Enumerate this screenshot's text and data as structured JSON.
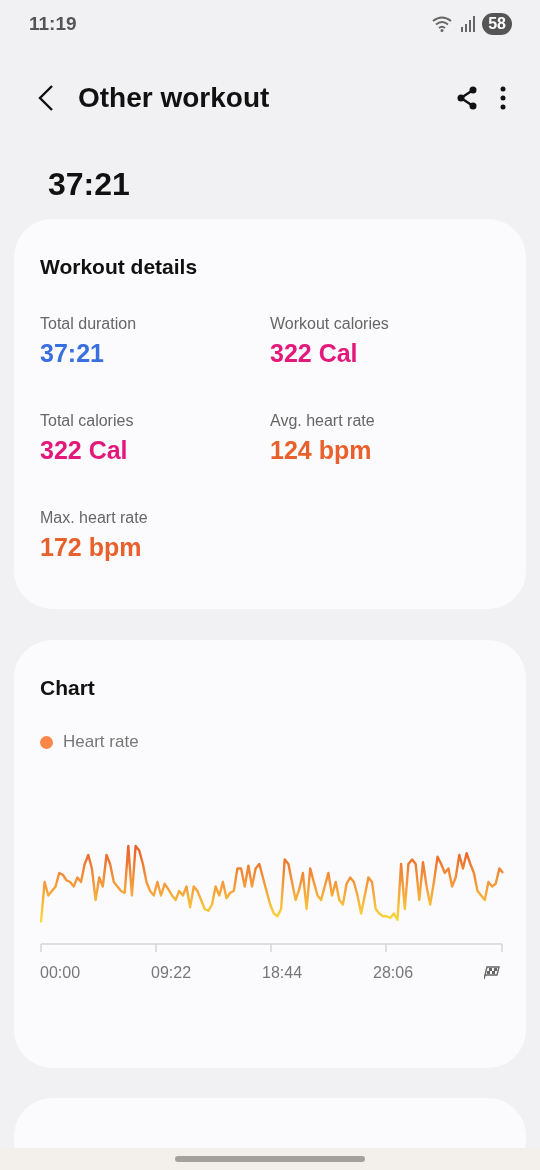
{
  "status_bar": {
    "time": "11:19",
    "battery": "58"
  },
  "header": {
    "title": "Other workout"
  },
  "duration": "37:21",
  "workout_details": {
    "title": "Workout details",
    "metrics": [
      {
        "label": "Total duration",
        "value": "37:21",
        "color": "#3a6fe0"
      },
      {
        "label": "Workout calories",
        "value": "322 Cal",
        "color": "#e2197b"
      },
      {
        "label": "Total calories",
        "value": "322 Cal",
        "color": "#e2197b"
      },
      {
        "label": "Avg. heart rate",
        "value": "124 bpm",
        "color": "#e8612c"
      },
      {
        "label": "Max. heart rate",
        "value": "172 bpm",
        "color": "#e8612c"
      }
    ]
  },
  "chart": {
    "title": "Chart",
    "legend": [
      {
        "label": "Heart rate",
        "color": "#fb8748"
      }
    ],
    "x_labels": [
      "00:00",
      "09:22",
      "18:44",
      "28:06"
    ]
  }
}
